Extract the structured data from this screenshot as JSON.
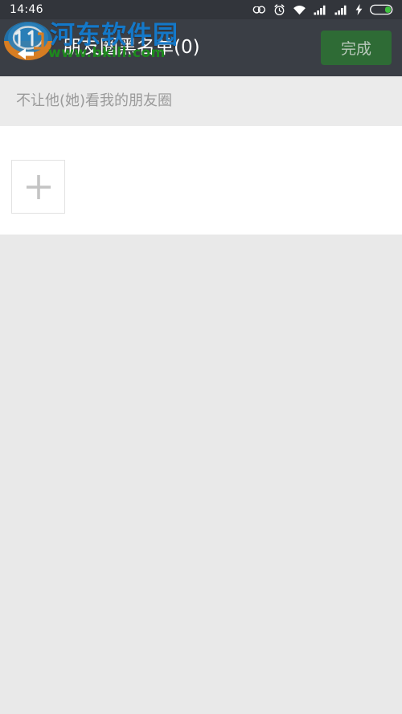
{
  "status_bar": {
    "clock": "14:46",
    "icons": [
      {
        "name": "sync-icon",
        "glyph": "sync"
      },
      {
        "name": "alarm-clock-icon",
        "glyph": "alarm"
      },
      {
        "name": "wifi-icon",
        "glyph": "wifi"
      },
      {
        "name": "signal-sim1-icon",
        "glyph": "signal"
      },
      {
        "name": "signal-sim2-icon",
        "glyph": "signal"
      },
      {
        "name": "charging-bolt-icon",
        "glyph": "bolt"
      },
      {
        "name": "battery-icon",
        "glyph": "battery"
      }
    ],
    "background_color": "#32353b"
  },
  "title_bar": {
    "title": "朋友圈黑名单(0)",
    "back_icon": "back-arrow-icon",
    "done_label": "完成",
    "background_color": "#3a3e45",
    "done_button_color": "#2e6b35",
    "done_text_color": "#b9c9bb"
  },
  "watermark": {
    "site_name": "河东软件园",
    "site_url": "www.bkill.com",
    "site_name_color": "#1478c8",
    "site_url_color": "#1d8a1d",
    "logo_icon": "site-logo-icon"
  },
  "section": {
    "header_label": "不让他(她)看我的朋友圈",
    "header_background": "#ebebeb",
    "header_text_color": "#9a9a9a"
  },
  "list": {
    "add_button_icon": "plus-icon",
    "add_button_border_color": "#e2e2e2",
    "plus_color": "#c4c4c4",
    "panel_background": "#ffffff",
    "contacts": []
  },
  "page": {
    "background_color": "#e9e9e9"
  }
}
